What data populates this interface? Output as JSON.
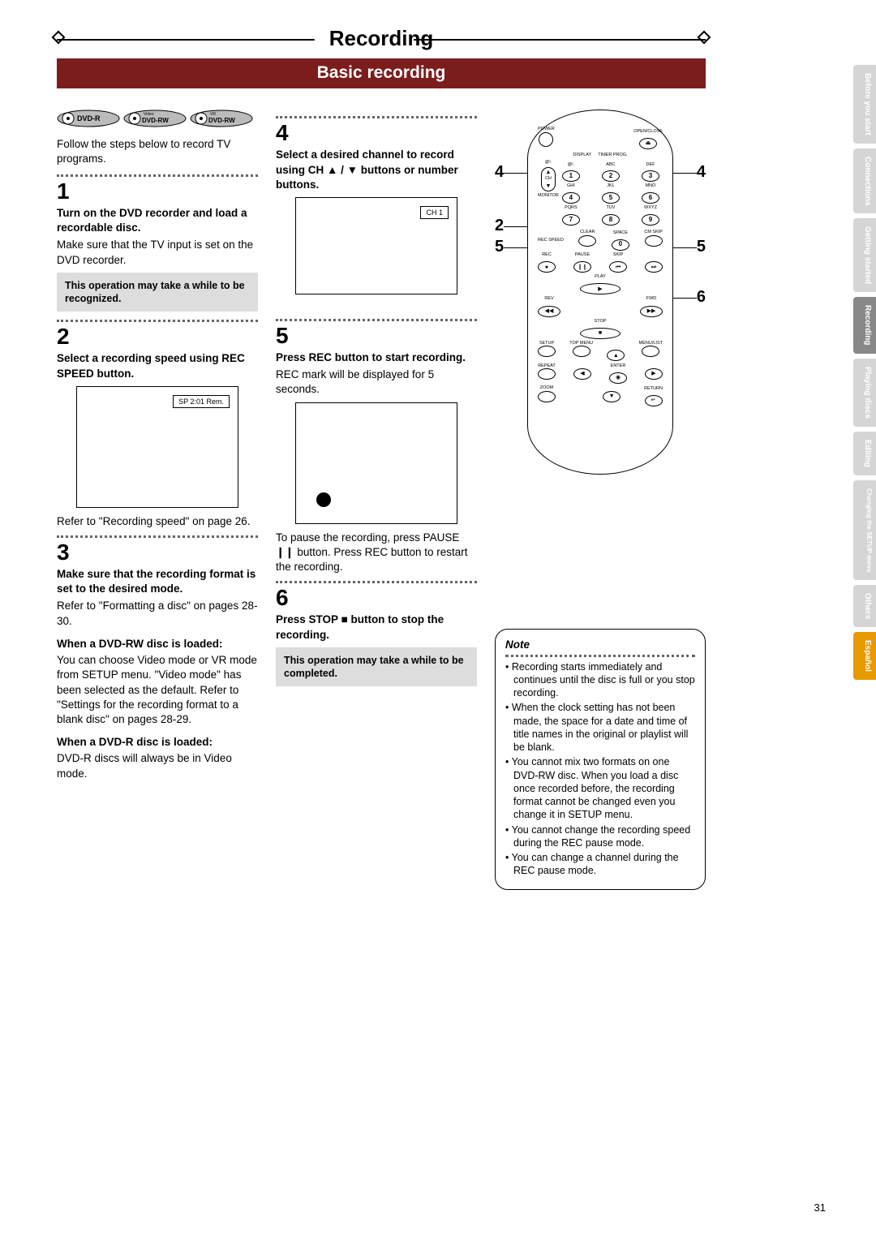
{
  "page": {
    "title": "Recording",
    "subtitle": "Basic recording",
    "number": "31",
    "intro": "Follow the steps below to record TV programs.",
    "disc_badges": [
      "DVD-R",
      "DVD-RW",
      "DVD-RW"
    ],
    "disc_badge_tops": [
      "",
      "Video",
      "VR"
    ]
  },
  "steps": {
    "s1": {
      "num": "1",
      "title": "Turn on the DVD recorder and load a recordable disc.",
      "body": "Make sure that the TV input is set on the DVD recorder.",
      "note": "This operation may take a while to be recognized."
    },
    "s2": {
      "num": "2",
      "title": "Select a recording speed using REC SPEED button.",
      "overlay": "SP 2:01 Rem.",
      "after": "Refer to \"Recording speed\" on page 26."
    },
    "s3": {
      "num": "3",
      "title": "Make sure that the recording format is set to the desired mode.",
      "body": "Refer to \"Formatting a disc\" on pages 28-30.",
      "rw_head": "When a DVD-RW disc is loaded:",
      "rw_body": "You can choose Video mode or VR mode from SETUP menu. \"Video mode\" has been selected as the default. Refer to \"Settings for the recording format to a blank disc\" on pages 28-29.",
      "r_head": "When a DVD-R disc is loaded:",
      "r_body": "DVD-R discs will always be in Video mode."
    },
    "s4": {
      "num": "4",
      "title": "Select a desired channel to record using CH ▲ / ▼ buttons or number buttons.",
      "overlay": "CH 1"
    },
    "s5": {
      "num": "5",
      "title": "Press REC button to start recording.",
      "body": "REC mark will be displayed for 5 seconds.",
      "after": "To pause the recording, press PAUSE ❙❙ button. Press REC button to restart the recording."
    },
    "s6": {
      "num": "6",
      "title": "Press STOP ■ button to stop the recording.",
      "note": "This operation may take a while to be completed."
    }
  },
  "note_box": {
    "title": "Note",
    "items": [
      "Recording starts immediately and continues until the disc is full or you stop recording.",
      "When the clock setting has not been made, the space for a date and time of title names in the original or playlist will be blank.",
      "You cannot mix two formats on one DVD-RW disc. When you load a disc once recorded before, the recording format cannot be changed even you change it in SETUP menu.",
      "You cannot change the recording speed during the REC pause mode.",
      "You can change a channel during the REC pause mode."
    ]
  },
  "side_tabs": [
    {
      "label": "Before you start",
      "cls": "light"
    },
    {
      "label": "Connections",
      "cls": "light"
    },
    {
      "label": "Getting started",
      "cls": "light"
    },
    {
      "label": "Recording",
      "cls": "dark"
    },
    {
      "label": "Playing discs",
      "cls": "light"
    },
    {
      "label": "Editing",
      "cls": "light"
    },
    {
      "label": "Changing the SETUP menu",
      "cls": "light"
    },
    {
      "label": "Others",
      "cls": "light"
    },
    {
      "label": "Español",
      "cls": "orange"
    }
  ],
  "remote": {
    "labels": {
      "power": "POWER",
      "open": "OPEN/CLOSE",
      "display": "DISPLAY",
      "timer": "TIMER PROG.",
      "at": "@!.",
      "abc": "ABC",
      "def": "DEF",
      "ghi": "GHI",
      "jkl": "JKL",
      "mno": "MNO",
      "pqrs": "PQRS",
      "tuv": "TUV",
      "wxyz": "WXYZ",
      "clear": "CLEAR",
      "space": "SPACE",
      "cmskip": "CM SKIP",
      "ch": "CH",
      "monitor": "MONITOR",
      "recspeed": "REC SPEED",
      "rec": "REC",
      "pause": "PAUSE",
      "skip": "SKIP",
      "play": "PLAY",
      "rev": "REV",
      "fwd": "FWD",
      "stop": "STOP",
      "setup": "SETUP",
      "topmenu": "TOP MENU",
      "menulist": "MENU/LIST",
      "repeat": "REPEAT",
      "enter": "ENTER",
      "zoom": "ZOOM",
      "return": "RETURN"
    },
    "callouts_left": [
      "4",
      "2",
      "5"
    ],
    "callouts_right": [
      "4",
      "5",
      "6"
    ]
  }
}
